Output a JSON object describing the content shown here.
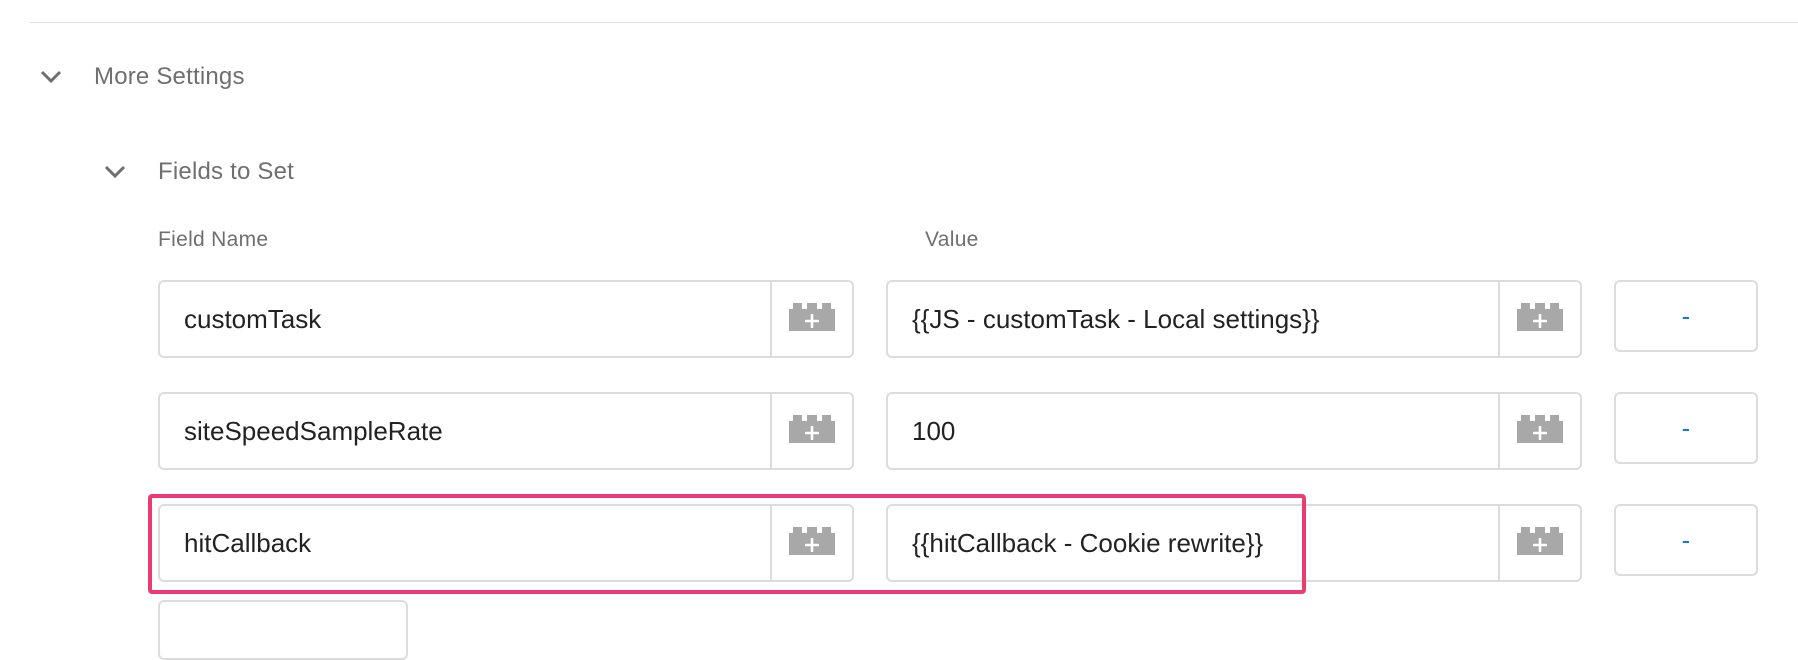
{
  "sections": {
    "more_settings": {
      "title": "More Settings",
      "expanded": true
    },
    "fields_to_set": {
      "title": "Fields to Set",
      "expanded": true
    }
  },
  "columns": {
    "field_name": "Field Name",
    "value": "Value"
  },
  "rows": [
    {
      "field": "customTask",
      "value": "{{JS - customTask - Local settings}}",
      "remove_label": "-"
    },
    {
      "field": "siteSpeedSampleRate",
      "value": "100",
      "remove_label": "-"
    },
    {
      "field": "hitCallback",
      "value": "{{hitCallback - Cookie rewrite}}",
      "remove_label": "-",
      "highlighted": true
    }
  ],
  "icons": {
    "chevron": "chevron-down-icon",
    "variable": "variable-picker-icon"
  },
  "colors": {
    "highlight": "#ec3b72",
    "accent": "#1a73e8",
    "icon_gray": "#a8a8a8"
  }
}
